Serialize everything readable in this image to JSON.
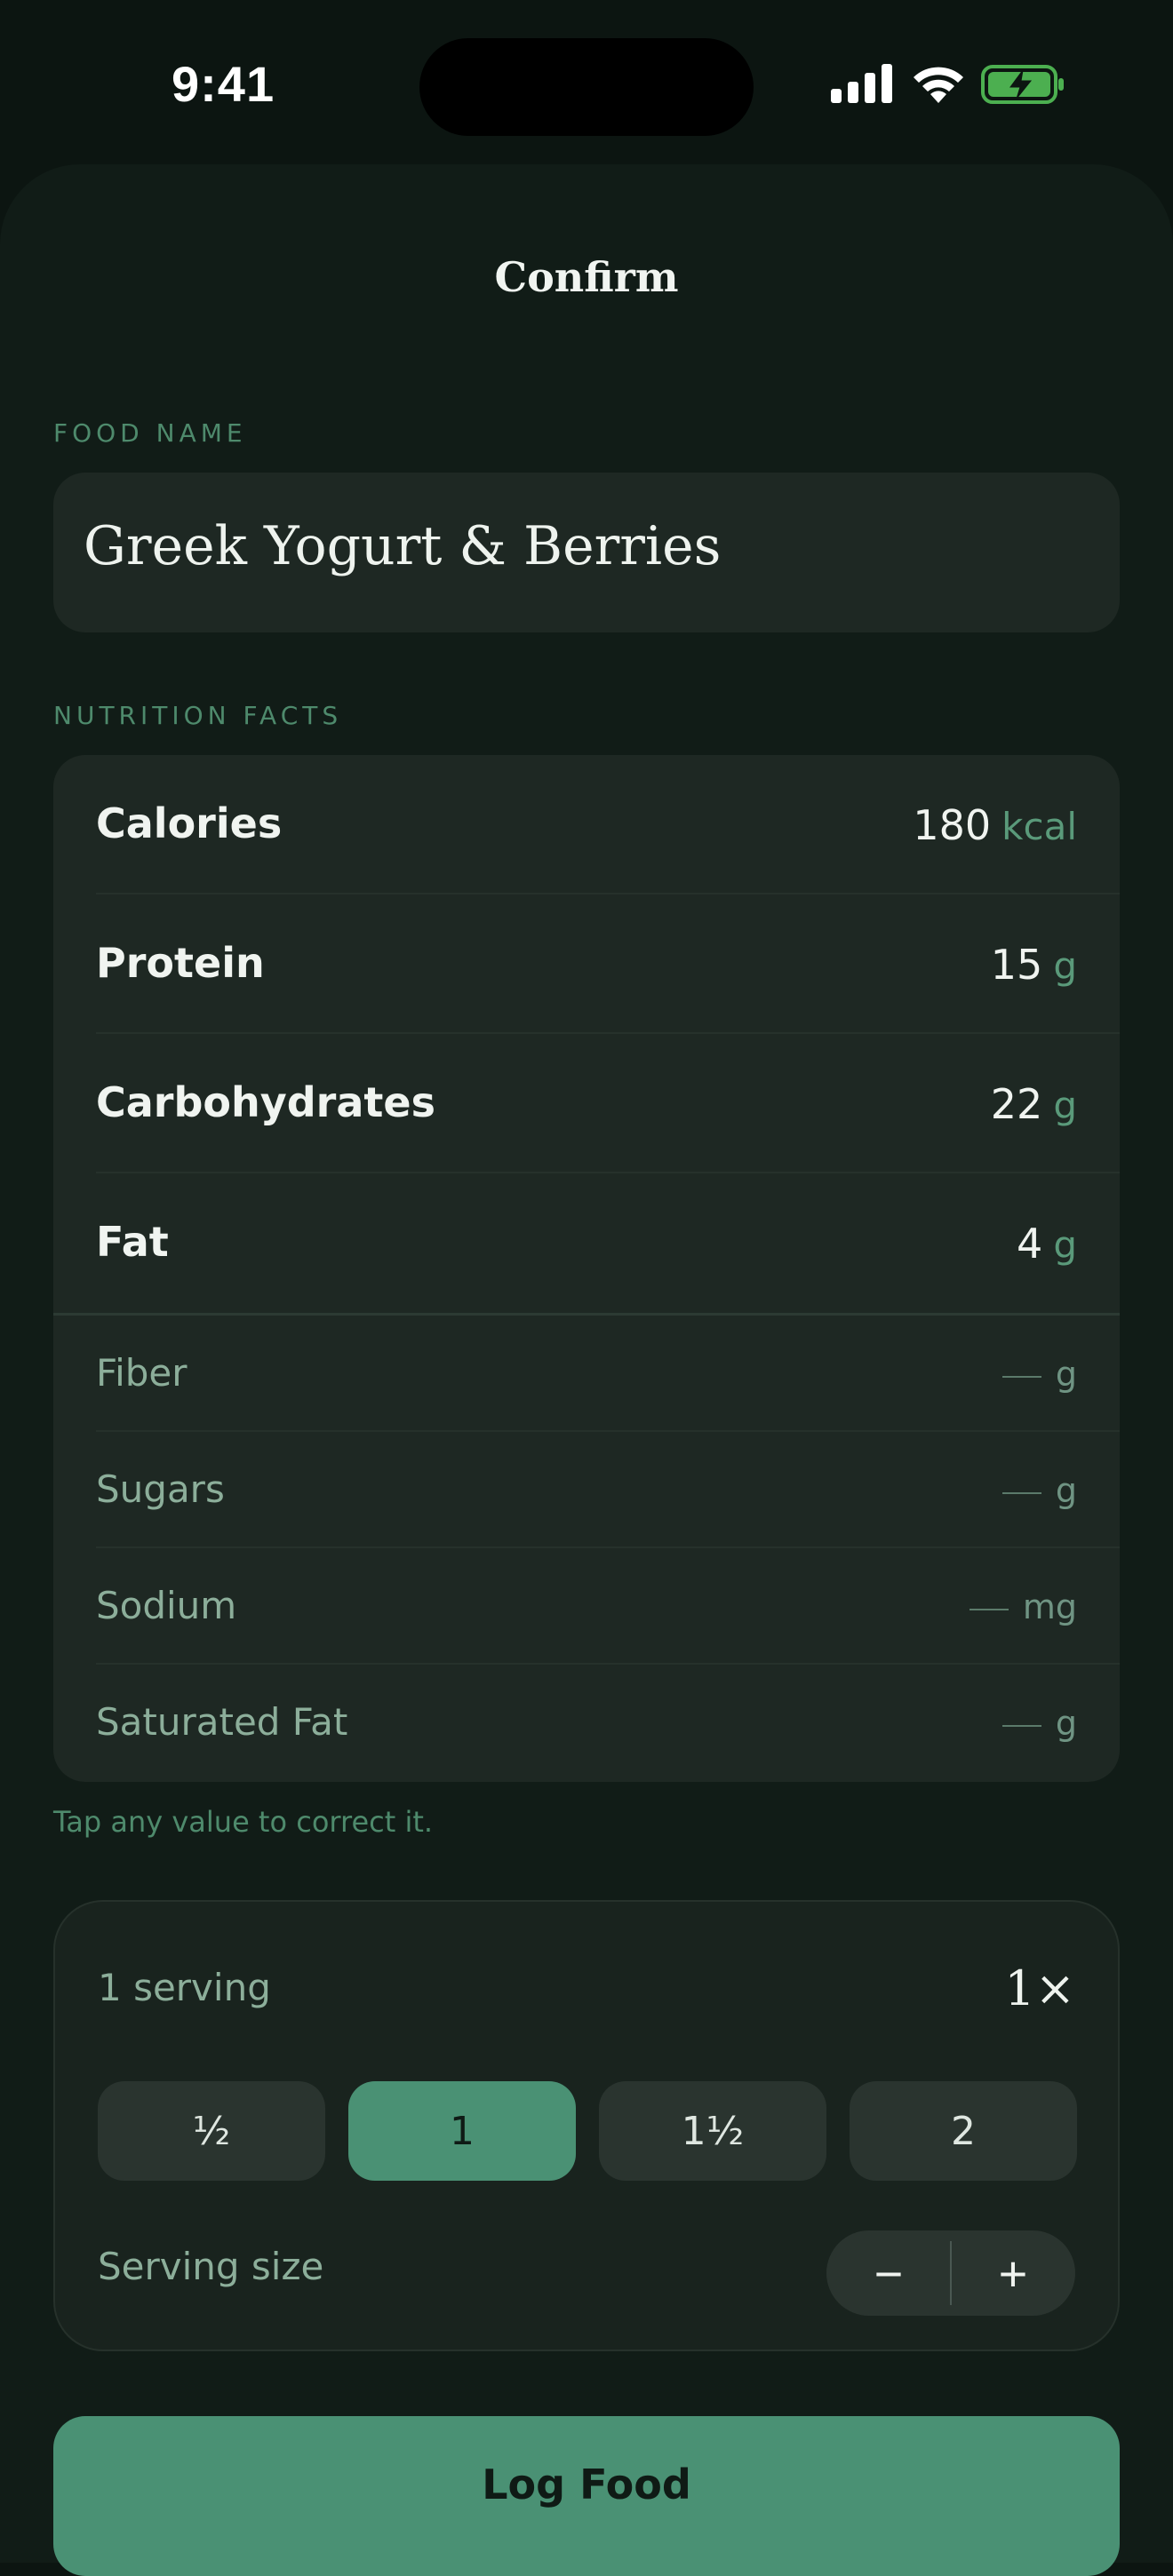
{
  "status_bar": {
    "time": "9:41",
    "icons": [
      "signal-icon",
      "wifi-icon",
      "battery-charging-icon"
    ],
    "battery_color": "#4caf50"
  },
  "sheet": {
    "title": "Confirm"
  },
  "food_name": {
    "label": "FOOD NAME",
    "value": "Greek Yogurt & Berries"
  },
  "nutrition": {
    "label": "NUTRITION FACTS",
    "macros": [
      {
        "label": "Calories",
        "value": "180",
        "unit": "kcal"
      },
      {
        "label": "Protein",
        "value": "15",
        "unit": "g"
      },
      {
        "label": "Carbohydrates",
        "value": "22",
        "unit": "g"
      },
      {
        "label": "Fat",
        "value": "4",
        "unit": "g"
      }
    ],
    "micros": [
      {
        "label": "Fiber",
        "unit": "g"
      },
      {
        "label": "Sugars",
        "unit": "g"
      },
      {
        "label": "Sodium",
        "unit": "mg"
      },
      {
        "label": "Saturated Fat",
        "unit": "g"
      }
    ],
    "hint": "Tap any value to correct it."
  },
  "serving": {
    "count_label": "1 serving",
    "multiplier": "1×",
    "chips": [
      {
        "label": "½",
        "active": false
      },
      {
        "label": "1",
        "active": true
      },
      {
        "label": "1½",
        "active": false
      },
      {
        "label": "2",
        "active": false
      }
    ],
    "size_label": "Serving size",
    "decrement_symbol": "−",
    "increment_symbol": "+"
  },
  "actions": {
    "log_label": "Log Food"
  },
  "colors": {
    "accent": "#4a9174",
    "background": "#0c1511",
    "card": "#1e2823",
    "muted_text": "#8cae9a"
  }
}
